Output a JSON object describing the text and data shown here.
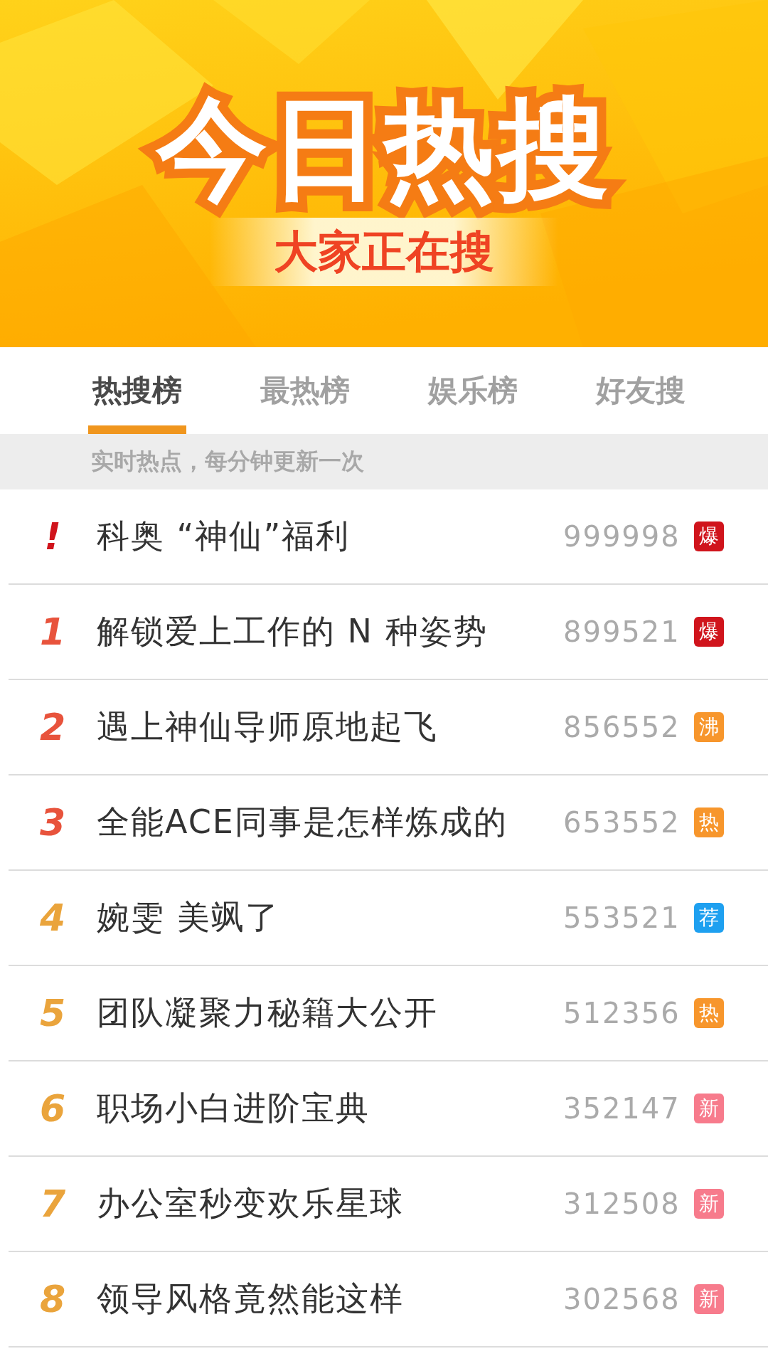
{
  "banner": {
    "title": "今日热搜",
    "subtitle": "大家正在搜"
  },
  "tabs": [
    {
      "label": "热搜榜",
      "selected": true
    },
    {
      "label": "最热榜",
      "selected": false
    },
    {
      "label": "娱乐榜",
      "selected": false
    },
    {
      "label": "好友搜",
      "selected": false
    }
  ],
  "notice": "实时热点，每分钟更新一次",
  "items": [
    {
      "rank": {
        "text": "!",
        "color": "#d0141c"
      },
      "title": "科奥 “神仙”福利",
      "count": "999998",
      "badge": {
        "text": "爆",
        "color": "#d0141c"
      }
    },
    {
      "rank": {
        "text": "1",
        "color": "#e8533c"
      },
      "title": "解锁爱上工作的 N 种姿势",
      "count": "899521",
      "badge": {
        "text": "爆",
        "color": "#d0141c"
      }
    },
    {
      "rank": {
        "text": "2",
        "color": "#e8533c"
      },
      "title": "遇上神仙导师原地起飞",
      "count": "856552",
      "badge": {
        "text": "沸",
        "color": "#f7962c"
      }
    },
    {
      "rank": {
        "text": "3",
        "color": "#e8533c"
      },
      "title": "全能ACE同事是怎样炼成的",
      "count": "653552",
      "badge": {
        "text": "热",
        "color": "#f7962c"
      }
    },
    {
      "rank": {
        "text": "4",
        "color": "#eaa43c"
      },
      "title": "婉雯 美飒了",
      "count": "553521",
      "badge": {
        "text": "荐",
        "color": "#1ea0f0"
      }
    },
    {
      "rank": {
        "text": "5",
        "color": "#eaa43c"
      },
      "title": "团队凝聚力秘籍大公开",
      "count": "512356",
      "badge": {
        "text": "热",
        "color": "#f7962c"
      }
    },
    {
      "rank": {
        "text": "6",
        "color": "#eaa43c"
      },
      "title": "职场小白进阶宝典",
      "count": "352147",
      "badge": {
        "text": "新",
        "color": "#f77b8c"
      }
    },
    {
      "rank": {
        "text": "7",
        "color": "#eaa43c"
      },
      "title": "办公室秒变欢乐星球",
      "count": "312508",
      "badge": {
        "text": "新",
        "color": "#f77b8c"
      }
    },
    {
      "rank": {
        "text": "8",
        "color": "#eaa43c"
      },
      "title": "领导风格竟然能这样",
      "count": "302568",
      "badge": {
        "text": "新",
        "color": "#f77b8c"
      }
    }
  ]
}
